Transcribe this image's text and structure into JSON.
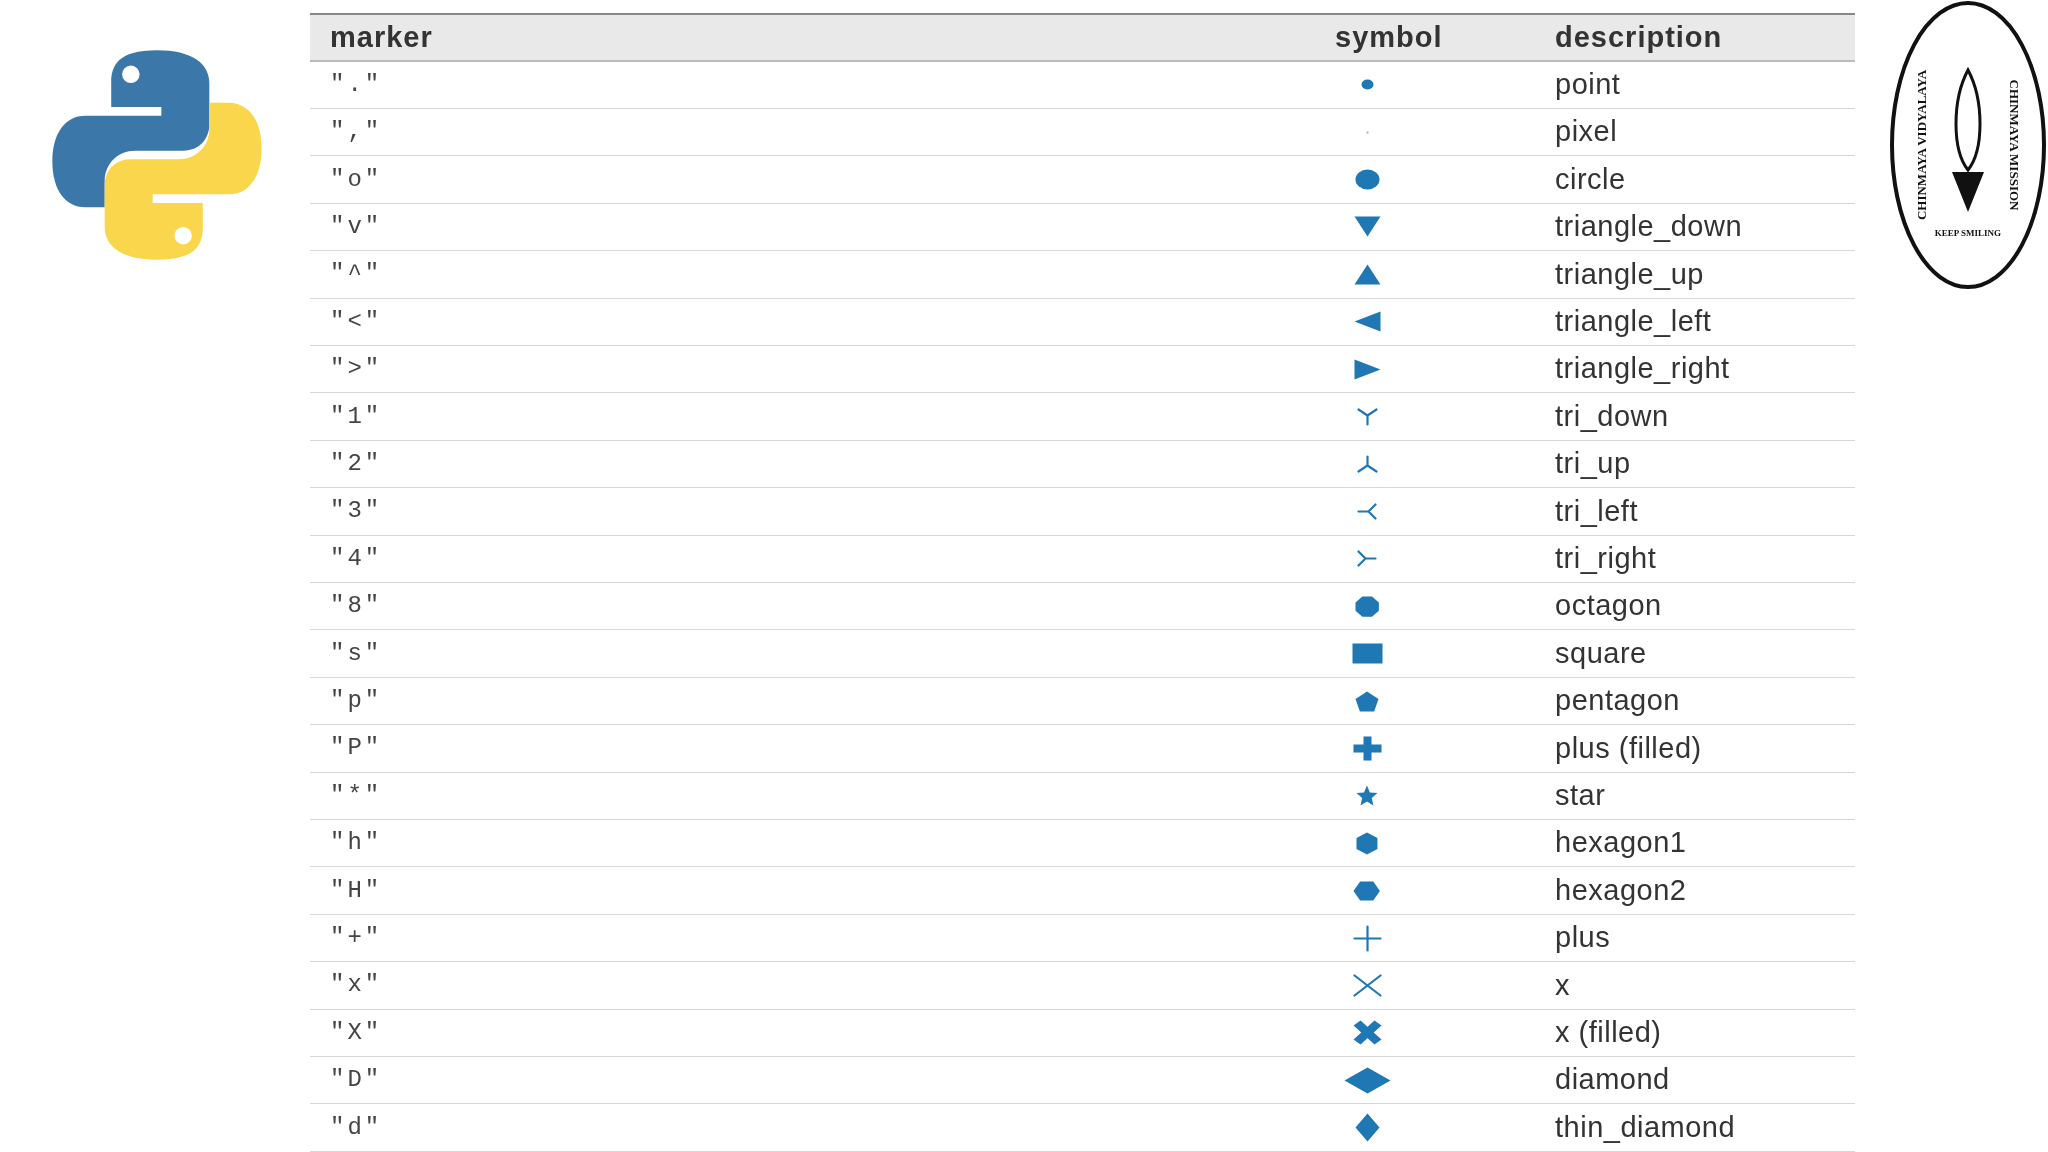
{
  "emblem": {
    "top_text": "CHINMAYA VIDYALAYA",
    "bottom_text": "CHINMAYA MISSION",
    "motto": "KEEP SMILING"
  },
  "table": {
    "columns": [
      "marker",
      "symbol",
      "description"
    ],
    "rows": [
      {
        "marker": "\".\"",
        "kind": "point",
        "description": "point"
      },
      {
        "marker": "\",\"",
        "kind": "pixel",
        "description": "pixel"
      },
      {
        "marker": "\"o\"",
        "kind": "circle",
        "description": "circle"
      },
      {
        "marker": "\"v\"",
        "kind": "triangle_down",
        "description": "triangle_down"
      },
      {
        "marker": "\"^\"",
        "kind": "triangle_up",
        "description": "triangle_up"
      },
      {
        "marker": "\"<\"",
        "kind": "triangle_left",
        "description": "triangle_left"
      },
      {
        "marker": "\">\"",
        "kind": "triangle_right",
        "description": "triangle_right"
      },
      {
        "marker": "\"1\"",
        "kind": "tri_down",
        "description": "tri_down"
      },
      {
        "marker": "\"2\"",
        "kind": "tri_up",
        "description": "tri_up"
      },
      {
        "marker": "\"3\"",
        "kind": "tri_left",
        "description": "tri_left"
      },
      {
        "marker": "\"4\"",
        "kind": "tri_right",
        "description": "tri_right"
      },
      {
        "marker": "\"8\"",
        "kind": "octagon",
        "description": "octagon"
      },
      {
        "marker": "\"s\"",
        "kind": "square",
        "description": "square"
      },
      {
        "marker": "\"p\"",
        "kind": "pentagon",
        "description": "pentagon"
      },
      {
        "marker": "\"P\"",
        "kind": "plus_filled",
        "description": "plus (filled)"
      },
      {
        "marker": "\"*\"",
        "kind": "star",
        "description": "star"
      },
      {
        "marker": "\"h\"",
        "kind": "hexagon1",
        "description": "hexagon1"
      },
      {
        "marker": "\"H\"",
        "kind": "hexagon2",
        "description": "hexagon2"
      },
      {
        "marker": "\"+\"",
        "kind": "plus",
        "description": "plus"
      },
      {
        "marker": "\"x\"",
        "kind": "x",
        "description": "x"
      },
      {
        "marker": "\"X\"",
        "kind": "x_filled",
        "description": "x (filled)"
      },
      {
        "marker": "\"D\"",
        "kind": "diamond",
        "description": "diamond"
      },
      {
        "marker": "\"d\"",
        "kind": "thin_diamond",
        "description": "thin_diamond"
      }
    ]
  }
}
